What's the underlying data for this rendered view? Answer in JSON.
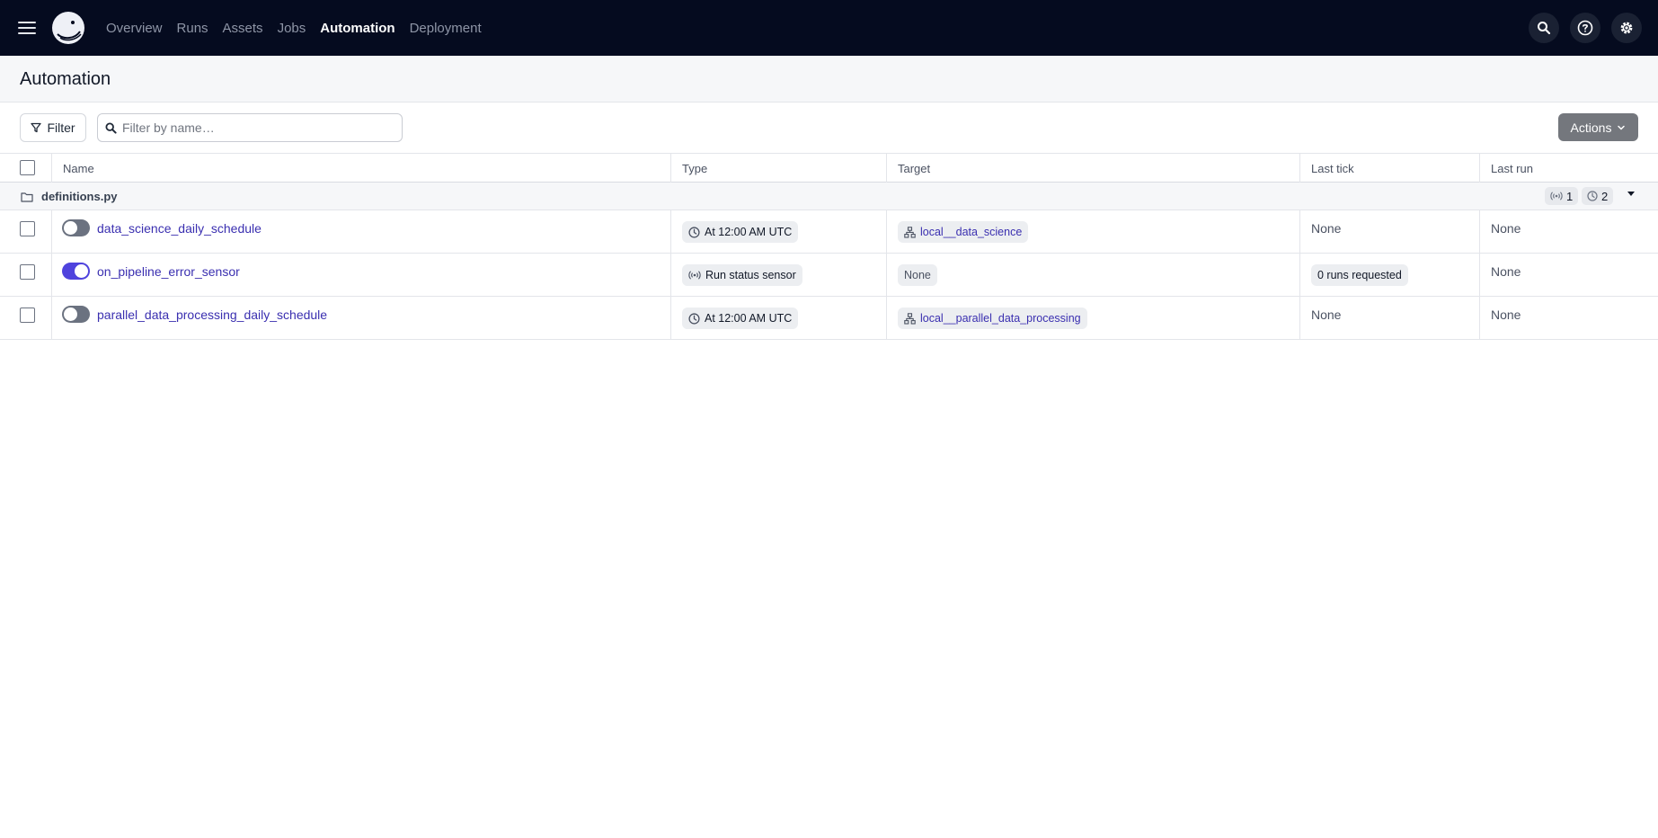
{
  "nav": {
    "items": [
      {
        "label": "Overview",
        "active": false
      },
      {
        "label": "Runs",
        "active": false
      },
      {
        "label": "Assets",
        "active": false
      },
      {
        "label": "Jobs",
        "active": false
      },
      {
        "label": "Automation",
        "active": true
      },
      {
        "label": "Deployment",
        "active": false
      }
    ],
    "icons": [
      "search-icon",
      "help-icon",
      "gear-icon"
    ]
  },
  "page": {
    "title": "Automation"
  },
  "toolbar": {
    "filter_label": "Filter",
    "search_placeholder": "Filter by name…",
    "search_value": "",
    "actions_label": "Actions"
  },
  "table": {
    "columns": [
      "Name",
      "Type",
      "Target",
      "Last tick",
      "Last run"
    ],
    "group": {
      "name": "definitions.py",
      "sensor_count": "1",
      "schedule_count": "2"
    },
    "rows": [
      {
        "name": "data_science_daily_schedule",
        "enabled": false,
        "type": "At 12:00 AM UTC",
        "type_icon": "clock-icon",
        "target": "local__data_science",
        "target_is_link": true,
        "last_tick": "None",
        "last_tick_is_tag": false,
        "last_run": "None"
      },
      {
        "name": "on_pipeline_error_sensor",
        "enabled": true,
        "type": "Run status sensor",
        "type_icon": "sensor-icon",
        "target": "None",
        "target_is_link": false,
        "last_tick": "0 runs requested",
        "last_tick_is_tag": true,
        "last_run": "None"
      },
      {
        "name": "parallel_data_processing_daily_schedule",
        "enabled": false,
        "type": "At 12:00 AM UTC",
        "type_icon": "clock-icon",
        "target": "local__parallel_data_processing",
        "target_is_link": true,
        "last_tick": "None",
        "last_tick_is_tag": false,
        "last_run": "None"
      }
    ]
  },
  "colors": {
    "topbar": "#050b1f",
    "accent": "#4f43dd",
    "link": "#3a2fb0",
    "actions_button": "#74777d"
  }
}
